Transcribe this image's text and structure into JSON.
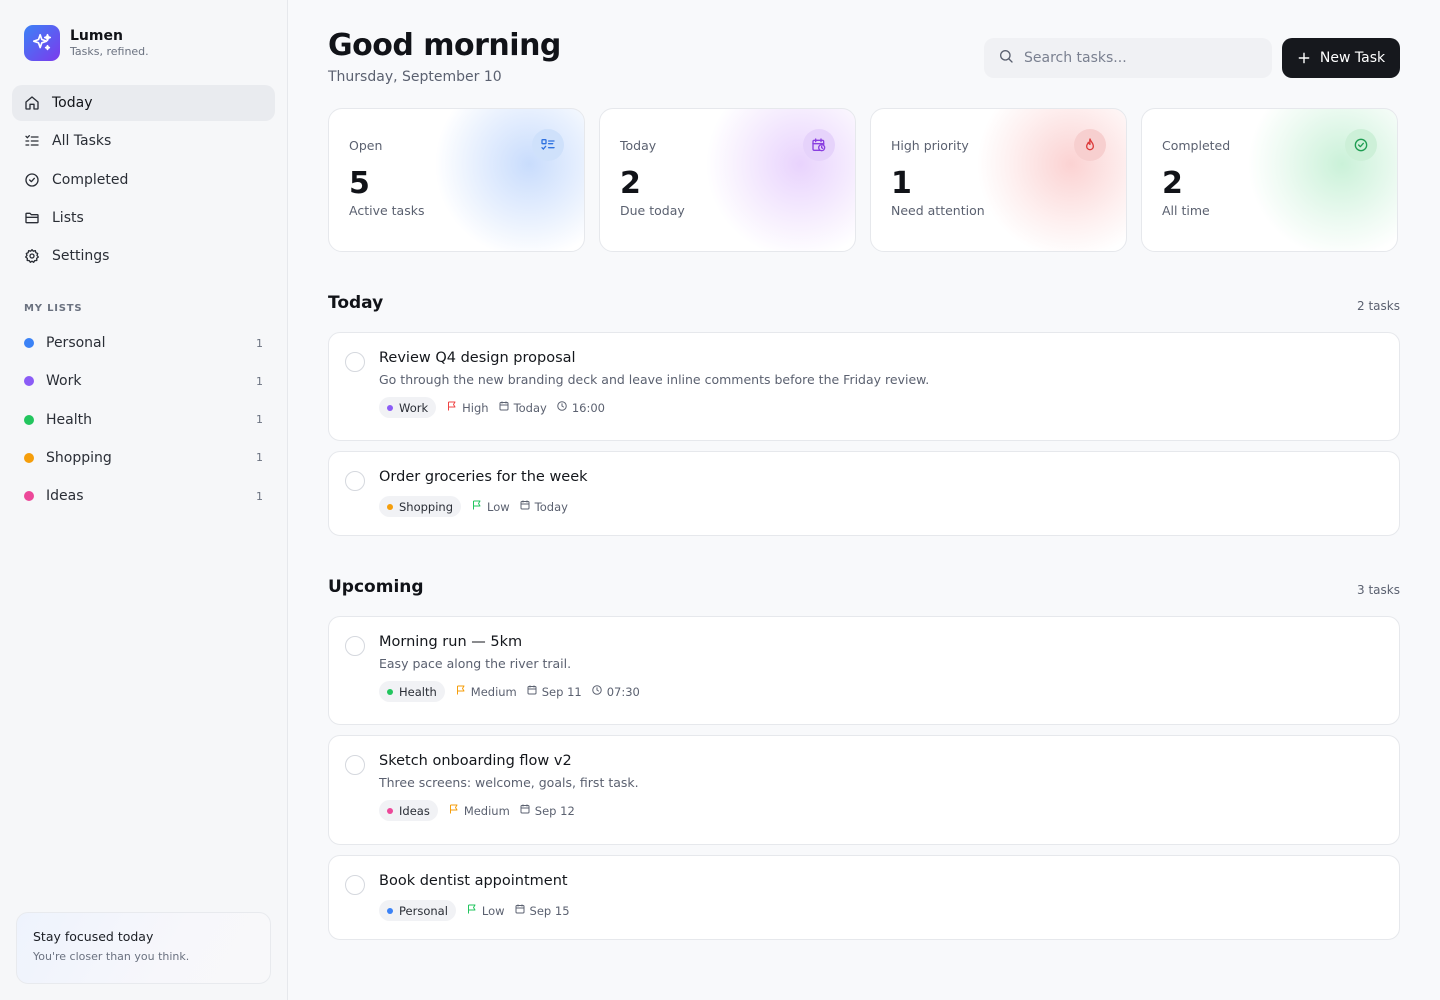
{
  "brand": {
    "name": "Lumen",
    "tagline": "Tasks, refined."
  },
  "nav": [
    {
      "label": "Today",
      "icon": "home-icon",
      "active": true
    },
    {
      "label": "All Tasks",
      "icon": "list-icon"
    },
    {
      "label": "Completed",
      "icon": "check-circle-icon"
    },
    {
      "label": "Lists",
      "icon": "folder-icon"
    },
    {
      "label": "Settings",
      "icon": "gear-icon"
    }
  ],
  "lists_title": "MY LISTS",
  "lists": [
    {
      "label": "Personal",
      "count": "1",
      "color": "#3b82f6"
    },
    {
      "label": "Work",
      "count": "1",
      "color": "#8b5cf6"
    },
    {
      "label": "Health",
      "count": "1",
      "color": "#22c55e"
    },
    {
      "label": "Shopping",
      "count": "1",
      "color": "#f59e0b"
    },
    {
      "label": "Ideas",
      "count": "1",
      "color": "#ec4899"
    }
  ],
  "focus": {
    "title": "Stay focused today",
    "subtitle": "You're closer than you think."
  },
  "header": {
    "greeting": "Good morning",
    "date": "Thursday, September 10"
  },
  "search": {
    "placeholder": "Search tasks..."
  },
  "new_task_label": "New Task",
  "stats": [
    {
      "label": "Open",
      "value": "5",
      "sub": "Active tasks",
      "icon": "checklist-icon",
      "color": "#3b82f6"
    },
    {
      "label": "Today",
      "value": "2",
      "sub": "Due today",
      "icon": "calendar-clock-icon",
      "color": "#a855f7"
    },
    {
      "label": "High priority",
      "value": "1",
      "sub": "Need attention",
      "icon": "flame-icon",
      "color": "#ef4444"
    },
    {
      "label": "Completed",
      "value": "2",
      "sub": "All time",
      "icon": "check-circle-icon",
      "color": "#22c55e"
    }
  ],
  "sections": {
    "today": {
      "title": "Today",
      "count": "2 tasks"
    },
    "upcoming": {
      "title": "Upcoming",
      "count": "3 tasks"
    }
  },
  "tasks": [
    {
      "title": "Review Q4 design proposal",
      "desc": "Go through the new branding deck and leave inline comments before the Friday review.",
      "list": "Work",
      "list_color": "#8b5cf6",
      "priority": "High",
      "priority_color": "#ef4444",
      "due": "Today",
      "time": "16:00"
    },
    {
      "title": "Order groceries for the week",
      "desc": "",
      "list": "Shopping",
      "list_color": "#f59e0b",
      "priority": "Low",
      "priority_color": "#22c55e",
      "due": "Today",
      "time": ""
    },
    {
      "title": "Morning run — 5km",
      "desc": "Easy pace along the river trail.",
      "list": "Health",
      "list_color": "#22c55e",
      "priority": "Medium",
      "priority_color": "#f59e0b",
      "due": "Sep 11",
      "time": "07:30"
    },
    {
      "title": "Sketch onboarding flow v2",
      "desc": "Three screens: welcome, goals, first task.",
      "list": "Ideas",
      "list_color": "#ec4899",
      "priority": "Medium",
      "priority_color": "#f59e0b",
      "due": "Sep 12",
      "time": ""
    },
    {
      "title": "Book dentist appointment",
      "desc": "",
      "list": "Personal",
      "list_color": "#3b82f6",
      "priority": "Low",
      "priority_color": "#22c55e",
      "due": "Sep 15",
      "time": ""
    }
  ]
}
